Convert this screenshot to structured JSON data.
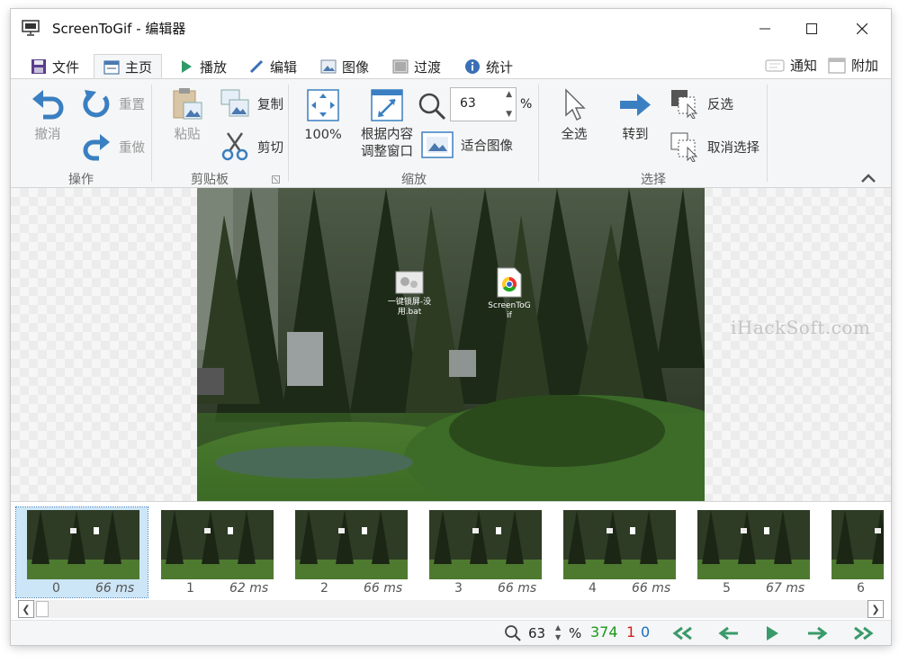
{
  "window": {
    "title": "ScreenToGif - 编辑器"
  },
  "tabs": [
    {
      "label": "文件",
      "icon": "save-icon"
    },
    {
      "label": "主页",
      "icon": "home-icon",
      "active": true
    },
    {
      "label": "播放",
      "icon": "play-icon"
    },
    {
      "label": "编辑",
      "icon": "pencil-icon"
    },
    {
      "label": "图像",
      "icon": "image-icon"
    },
    {
      "label": "过渡",
      "icon": "transition-icon"
    },
    {
      "label": "统计",
      "icon": "info-icon"
    }
  ],
  "header_right": {
    "notify_label": "通知",
    "extra_label": "附加"
  },
  "ribbon": {
    "actions": {
      "undo": "撤消",
      "reset": "重置",
      "redo": "重做",
      "group": "操作"
    },
    "clipboard": {
      "paste": "粘贴",
      "copy": "复制",
      "cut": "剪切",
      "group": "剪贴板"
    },
    "zoom": {
      "actual": "100%",
      "fit_window_line1": "根据内容",
      "fit_window_line2": "调整窗口",
      "value": "63",
      "unit": "%",
      "fit_image": "适合图像",
      "group": "缩放"
    },
    "select": {
      "select_all": "全选",
      "goto": "转到",
      "invert": "反选",
      "deselect": "取消选择",
      "group": "选择"
    }
  },
  "canvas": {
    "watermark": "iHackSoft.com",
    "desktop_icons": [
      {
        "label_line1": "一键锁屏-没",
        "label_line2": "用.bat"
      },
      {
        "label_line1": "ScreenToG",
        "label_line2": "if"
      }
    ]
  },
  "frames": [
    {
      "index": "0",
      "delay": "66 ms",
      "selected": true
    },
    {
      "index": "1",
      "delay": "62 ms"
    },
    {
      "index": "2",
      "delay": "66 ms"
    },
    {
      "index": "3",
      "delay": "66 ms"
    },
    {
      "index": "4",
      "delay": "66 ms"
    },
    {
      "index": "5",
      "delay": "67 ms"
    },
    {
      "index": "6",
      "delay": ""
    }
  ],
  "statusbar": {
    "zoom_value": "63",
    "zoom_unit": "%",
    "frame_count": "374",
    "selected_count": "1",
    "current_frame": "0",
    "colors": {
      "count": "#1a9a1a",
      "selected": "#d02020",
      "current": "#1a6fc0",
      "nav": "#3a9a6a"
    }
  }
}
